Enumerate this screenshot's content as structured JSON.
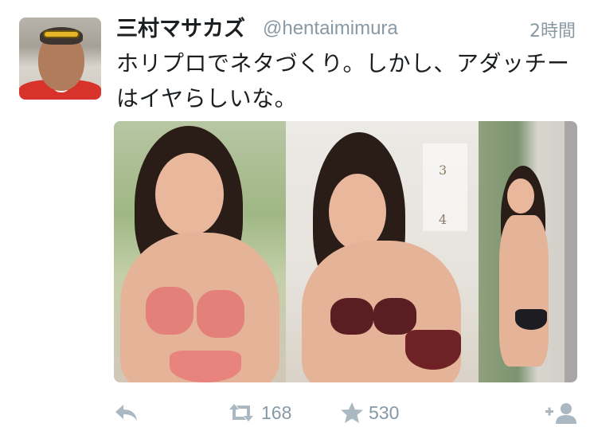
{
  "tweet": {
    "display_name": "三村マサカズ",
    "handle": "@hentaimimura",
    "time": "2時間",
    "text": "ホリプロでネタづくり。しかし、アダッチーはイヤらしいな。"
  },
  "media": {
    "calendar_numbers": [
      "3",
      "4"
    ]
  },
  "actions": {
    "reply": {
      "icon": "reply-icon"
    },
    "retweet": {
      "icon": "retweet-icon",
      "count": "168"
    },
    "favorite": {
      "icon": "star-icon",
      "count": "530"
    },
    "follow": {
      "icon": "add-user-icon"
    }
  },
  "colors": {
    "text": "#1b1f22",
    "muted": "#8899a6",
    "icon": "#aab8c2"
  }
}
